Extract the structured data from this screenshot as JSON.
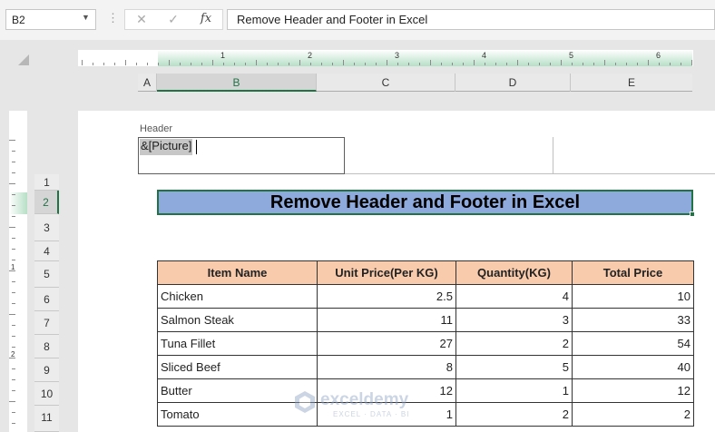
{
  "formula_bar": {
    "name_box": "B2",
    "cancel_icon": "✕",
    "enter_icon": "✓",
    "fx_label": "fx",
    "formula": "Remove Header and Footer in Excel"
  },
  "ruler": {
    "numbers": [
      "1",
      "2",
      "3",
      "4",
      "5",
      "6"
    ]
  },
  "left_ruler": {
    "numbers": [
      "1",
      "2"
    ]
  },
  "columns": [
    "A",
    "B",
    "C",
    "D",
    "E"
  ],
  "rows": [
    "1",
    "2",
    "3",
    "4",
    "5",
    "6",
    "7",
    "8",
    "9",
    "10",
    "11"
  ],
  "page_header": {
    "label": "Header",
    "left_section_text": "&[Picture]",
    "center_section_text": "",
    "right_section_text": ""
  },
  "sheet": {
    "title": "Remove Header and Footer in Excel",
    "table": {
      "headers": [
        "Item Name",
        "Unit Price(Per KG)",
        "Quantity(KG)",
        "Total Price"
      ],
      "rows": [
        [
          "Chicken",
          "2.5",
          "4",
          "10"
        ],
        [
          "Salmon Steak",
          "11",
          "3",
          "33"
        ],
        [
          "Tuna Fillet",
          "27",
          "2",
          "54"
        ],
        [
          "Sliced Beef",
          "8",
          "5",
          "40"
        ],
        [
          "Butter",
          "12",
          "1",
          "12"
        ],
        [
          "Tomato",
          "1",
          "2",
          "2"
        ]
      ]
    }
  },
  "watermark": {
    "name": "exceldemy",
    "tagline": "EXCEL · DATA · BI"
  },
  "colors": {
    "accent_green": "#217346",
    "title_fill": "#8ea9db",
    "table_header_fill": "#f8cbad"
  }
}
